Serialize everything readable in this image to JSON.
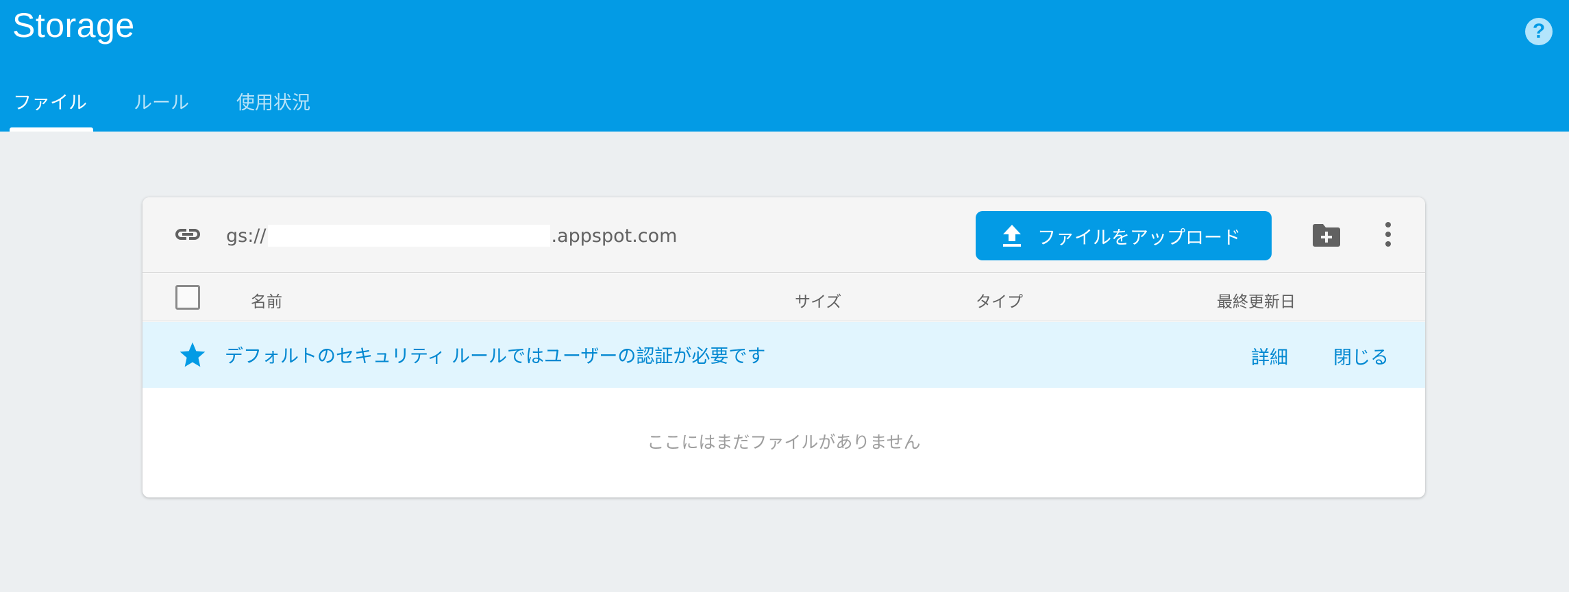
{
  "header": {
    "title": "Storage",
    "help_icon": "help-circle-icon",
    "help_glyph": "?",
    "tabs": [
      {
        "label": "ファイル",
        "active": true
      },
      {
        "label": "ルール",
        "active": false
      },
      {
        "label": "使用状況",
        "active": false
      }
    ]
  },
  "bucket": {
    "link_icon": "link-icon",
    "url_prefix": "gs://",
    "url_suffix": ".appspot.com",
    "upload_label": "ファイルをアップロード",
    "upload_icon": "upload-icon",
    "new_folder_icon": "create-folder-icon",
    "more_icon": "more-vert-icon"
  },
  "table": {
    "columns": [
      "名前",
      "サイズ",
      "タイプ",
      "最終更新日"
    ]
  },
  "notice": {
    "icon": "star-icon",
    "text": "デフォルトのセキュリティ ルールではユーザーの認証が必要です",
    "details_label": "詳細",
    "close_label": "閉じる"
  },
  "empty_state": "ここにはまだファイルがありません",
  "colors": {
    "appbar": "#039be5",
    "background": "#eceff1",
    "notice_bg": "#e1f5fe",
    "accent_text": "#0288d1"
  }
}
